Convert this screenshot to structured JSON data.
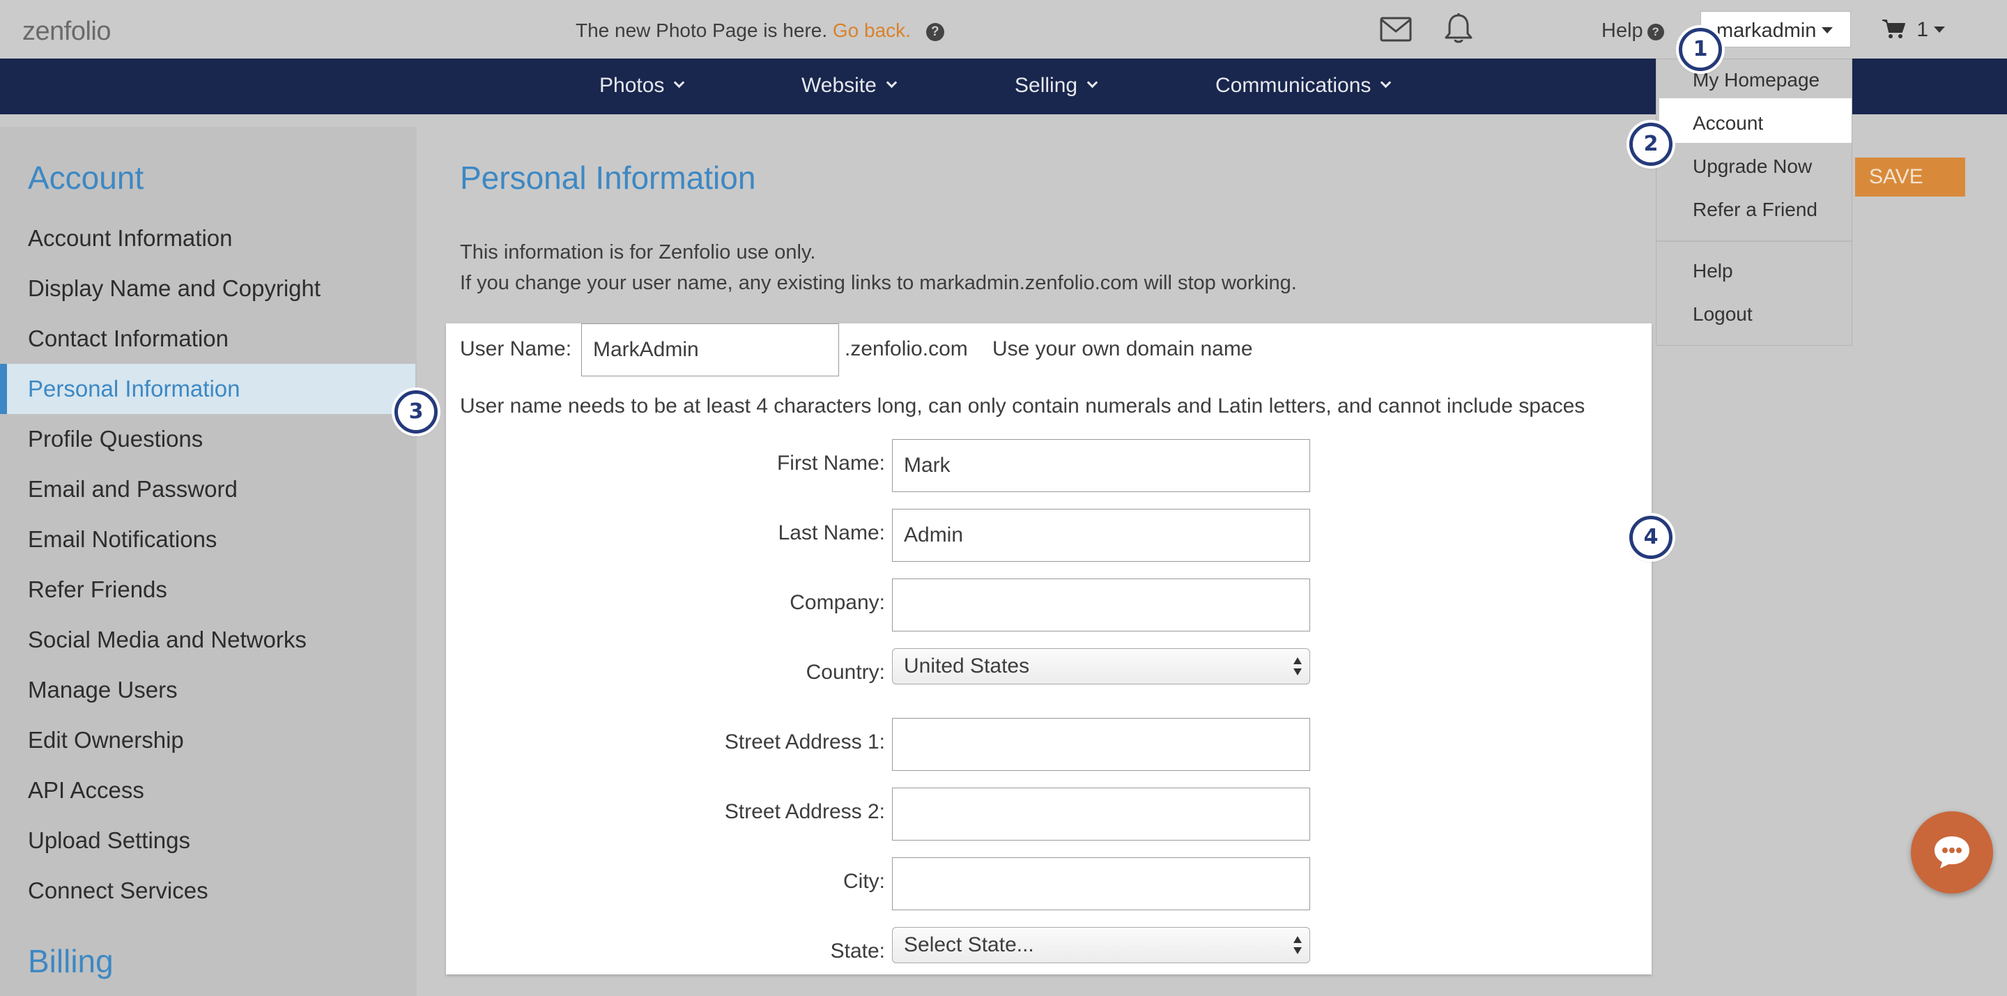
{
  "topbar": {
    "logo": "zenfolio",
    "notice_text": "The new Photo Page is here.",
    "notice_link": "Go back.",
    "help_label": "Help",
    "user_label": "markadmin",
    "cart_count": "1",
    "icons": [
      "mail-icon",
      "bell-icon",
      "question-icon",
      "cart-icon"
    ]
  },
  "nav": {
    "items": [
      {
        "label": "Photos"
      },
      {
        "label": "Website"
      },
      {
        "label": "Selling"
      },
      {
        "label": "Communications"
      }
    ]
  },
  "sidebar": {
    "account_title": "Account",
    "items": [
      {
        "label": "Account Information"
      },
      {
        "label": "Display Name and Copyright"
      },
      {
        "label": "Contact Information"
      },
      {
        "label": "Personal Information",
        "active": true
      },
      {
        "label": "Profile Questions"
      },
      {
        "label": "Email and Password"
      },
      {
        "label": "Email Notifications"
      },
      {
        "label": "Refer Friends"
      },
      {
        "label": "Social Media and Networks"
      },
      {
        "label": "Manage Users"
      },
      {
        "label": "Edit Ownership"
      },
      {
        "label": "API Access"
      },
      {
        "label": "Upload Settings"
      },
      {
        "label": "Connect Services"
      }
    ],
    "billing_title": "Billing"
  },
  "main": {
    "title": "Personal Information",
    "info_line_1": "This information is for Zenfolio use only.",
    "info_line_2": "If you change your user name, any existing links to markadmin.zenfolio.com will stop working.",
    "save_label": "SAVE"
  },
  "form": {
    "username_label": "User Name:",
    "username_value": "MarkAdmin",
    "domain_suffix": ".zenfolio.com",
    "domain_link": "Use your own domain name",
    "username_note": "User name needs to be at least 4 characters long, can only contain numerals and Latin letters, and cannot include spaces",
    "first_name_label": "First Name:",
    "first_name_value": "Mark",
    "last_name_label": "Last Name:",
    "last_name_value": "Admin",
    "company_label": "Company:",
    "company_value": "",
    "country_label": "Country:",
    "country_value": "United States",
    "street1_label": "Street Address 1:",
    "street1_value": "",
    "street2_label": "Street Address 2:",
    "street2_value": "",
    "city_label": "City:",
    "city_value": "",
    "state_label": "State:",
    "state_value": "Select State..."
  },
  "dropdown": {
    "items": [
      {
        "label": "My Homepage"
      },
      {
        "label": "Account",
        "active": true
      },
      {
        "label": "Upgrade Now"
      },
      {
        "label": "Refer a Friend"
      },
      {
        "label": "Help"
      },
      {
        "label": "Logout"
      }
    ]
  },
  "markers": [
    "1",
    "2",
    "3",
    "4"
  ],
  "colors": {
    "accent_blue": "#3d88c4",
    "nav_bg": "#19264d",
    "orange": "#d9822b",
    "marker_blue": "#253a7a"
  }
}
